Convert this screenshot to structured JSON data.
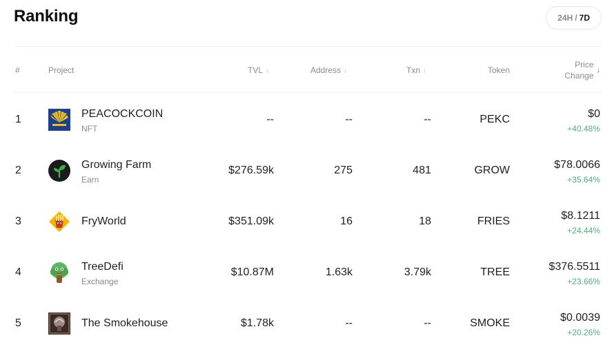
{
  "header": {
    "title": "Ranking",
    "period_24h": "24H",
    "period_sep": "/",
    "period_7d": "7D"
  },
  "columns": {
    "rank": "#",
    "project": "Project",
    "tvl": "TVL",
    "address": "Address",
    "txn": "Txn",
    "token": "Token",
    "price_line1": "Price",
    "price_line2": "Change",
    "sort_icon": "sort-down-arrow"
  },
  "rows": [
    {
      "rank": "1",
      "name": "PEACOCKCOIN",
      "category": "NFT",
      "tvl": "--",
      "address": "--",
      "txn": "--",
      "token": "PEKC",
      "price": "$0",
      "change": "+40.48%",
      "logo": "peacock-logo"
    },
    {
      "rank": "2",
      "name": "Growing Farm",
      "category": "Earn",
      "tvl": "$276.59k",
      "address": "275",
      "txn": "481",
      "token": "GROW",
      "price": "$78.0066",
      "change": "+35.64%",
      "logo": "sprout-logo"
    },
    {
      "rank": "3",
      "name": "FryWorld",
      "category": "",
      "tvl": "$351.09k",
      "address": "16",
      "txn": "18",
      "token": "FRIES",
      "price": "$8.1211",
      "change": "+24.44%",
      "logo": "fries-logo"
    },
    {
      "rank": "4",
      "name": "TreeDefi",
      "category": "Exchange",
      "tvl": "$10.87M",
      "address": "1.63k",
      "txn": "3.79k",
      "token": "TREE",
      "price": "$376.5511",
      "change": "+23.66%",
      "logo": "tree-logo"
    },
    {
      "rank": "5",
      "name": "The Smokehouse",
      "category": "",
      "tvl": "$1.78k",
      "address": "--",
      "txn": "--",
      "token": "SMOKE",
      "price": "$0.0039",
      "change": "+20.26%",
      "logo": "smokehouse-logo"
    }
  ],
  "colors": {
    "positive": "#4cb07a",
    "muted": "#8a8a8a",
    "text": "#1f1f1f"
  }
}
